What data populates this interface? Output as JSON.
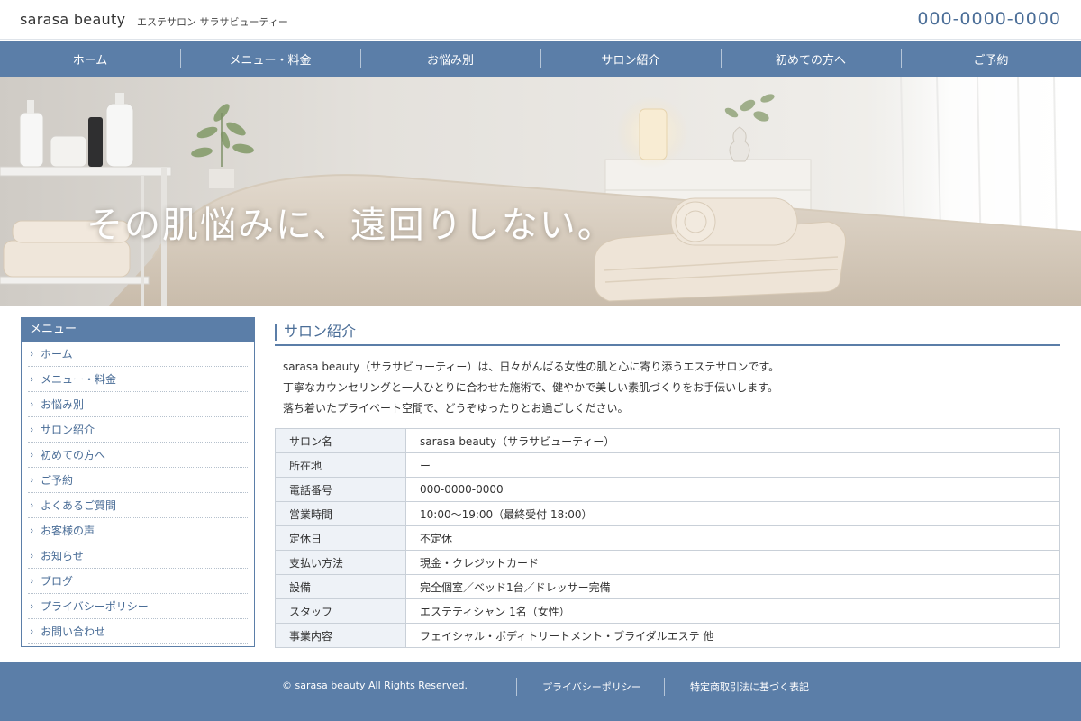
{
  "header": {
    "brand": "sarasa beauty",
    "tagline": "エステサロン サラサビューティー",
    "phone": "000-0000-0000"
  },
  "nav": {
    "items": [
      "ホーム",
      "メニュー・料金",
      "お悩み別",
      "サロン紹介",
      "初めての方へ",
      "ご予約"
    ]
  },
  "hero": {
    "headline": "その肌悩みに、遠回りしない。"
  },
  "sidebar": {
    "title": "メニュー",
    "items": [
      "ホーム",
      "メニュー・料金",
      "お悩み別",
      "サロン紹介",
      "初めての方へ",
      "ご予約",
      "よくあるご質問",
      "お客様の声",
      "お知らせ",
      "ブログ",
      "プライバシーポリシー",
      "お問い合わせ"
    ]
  },
  "main": {
    "title": "サロン紹介",
    "intro": [
      "sarasa beauty（サラサビューティー）は、日々がんばる女性の肌と心に寄り添うエステサロンです。",
      "丁寧なカウンセリングと一人ひとりに合わせた施術で、健やかで美しい素肌づくりをお手伝いします。",
      "落ち着いたプライベート空間で、どうぞゆったりとお過ごしください。"
    ],
    "info": [
      {
        "label": "サロン名",
        "value": "sarasa beauty（サラサビューティー）"
      },
      {
        "label": "所在地",
        "value": "ー"
      },
      {
        "label": "電話番号",
        "value": "000-0000-0000"
      },
      {
        "label": "営業時間",
        "value": "10:00〜19:00（最終受付 18:00）"
      },
      {
        "label": "定休日",
        "value": "不定休"
      },
      {
        "label": "支払い方法",
        "value": "現金・クレジットカード"
      },
      {
        "label": "設備",
        "value": "完全個室／ベッド1台／ドレッサー完備"
      },
      {
        "label": "スタッフ",
        "value": "エステティシャン 1名（女性）"
      },
      {
        "label": "事業内容",
        "value": "フェイシャル・ボディトリートメント・ブライダルエステ 他"
      }
    ]
  },
  "footer": {
    "copyright": "© sarasa beauty All Rights Reserved.",
    "links": [
      "プライバシーポリシー",
      "特定商取引法に基づく表記"
    ]
  },
  "colors": {
    "brand_blue": "#5b7ea8",
    "text_blue": "#4a6d97",
    "table_header_bg": "#eef2f7"
  }
}
